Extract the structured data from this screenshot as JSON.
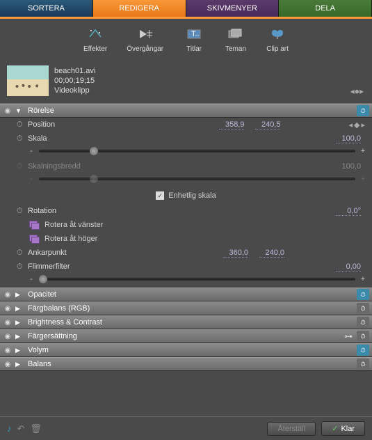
{
  "tabs": {
    "sort": "SORTERA",
    "edit": "REDIGERA",
    "disc": "SKIVMENYER",
    "share": "DELA"
  },
  "toolbar": {
    "effects": "Effekter",
    "transitions": "Övergångar",
    "titles": "Titlar",
    "themes": "Teman",
    "clipart": "Clip art"
  },
  "clip": {
    "name": "beach01.avi",
    "time": "00;00;19;15",
    "type": "Videoklipp"
  },
  "sections": {
    "motion": {
      "title": "Rörelse",
      "position": {
        "label": "Position",
        "x": "358,9",
        "y": "240,5"
      },
      "scale": {
        "label": "Skala",
        "val": "100,0"
      },
      "scalew": {
        "label": "Skalningsbredd",
        "val": "100,0"
      },
      "uniform": "Enhetlig skala",
      "rotation": {
        "label": "Rotation",
        "val": "0,0"
      },
      "rotleft": "Rotera åt vänster",
      "rotright": "Rotera åt höger",
      "anchor": {
        "label": "Ankarpunkt",
        "x": "360,0",
        "y": "240,0"
      },
      "flicker": {
        "label": "Flimmerfilter",
        "val": "0,00"
      }
    },
    "opacity": "Opacitet",
    "rgb": "Färgbalans (RGB)",
    "bc": "Brightness & Contrast",
    "colorize": "Färgersättning",
    "volume": "Volym",
    "balance": "Balans"
  },
  "footer": {
    "reset": "Återställ",
    "done": "Klar"
  }
}
